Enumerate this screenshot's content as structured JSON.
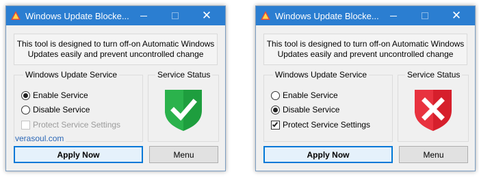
{
  "windows": [
    {
      "title": "Windows Update Blocke...",
      "description_line1": "This tool is designed to turn off-on Automatic Windows",
      "description_line2": "Updates easily and prevent uncontrolled change",
      "service_group_label": "Windows Update Service",
      "status_group_label": "Service Status",
      "enable_label": "Enable Service",
      "disable_label": "Disable Service",
      "protect_label": "Protect Service Settings",
      "selected": "enable",
      "protect_checked": false,
      "protect_enabled": false,
      "status": "enabled",
      "status_icon": "green-shield-check-icon",
      "status_color": "#1e9e3e",
      "credit": "verasoul.com",
      "apply_label": "Apply Now",
      "menu_label": "Menu"
    },
    {
      "title": "Windows Update Blocke...",
      "description_line1": "This tool is designed to turn off-on Automatic Windows",
      "description_line2": "Updates easily and prevent uncontrolled change",
      "service_group_label": "Windows Update Service",
      "status_group_label": "Service Status",
      "enable_label": "Enable Service",
      "disable_label": "Disable Service",
      "protect_label": "Protect Service Settings",
      "selected": "disable",
      "protect_checked": true,
      "protect_enabled": true,
      "status": "disabled",
      "status_icon": "red-shield-x-icon",
      "status_color": "#d61f2c",
      "apply_label": "Apply Now",
      "menu_label": "Menu"
    }
  ],
  "colors": {
    "titlebar": "#2b7ed1",
    "window_bg": "#f0f0f0",
    "accent_border": "#0078d7",
    "credit_link": "#2a66b6"
  }
}
